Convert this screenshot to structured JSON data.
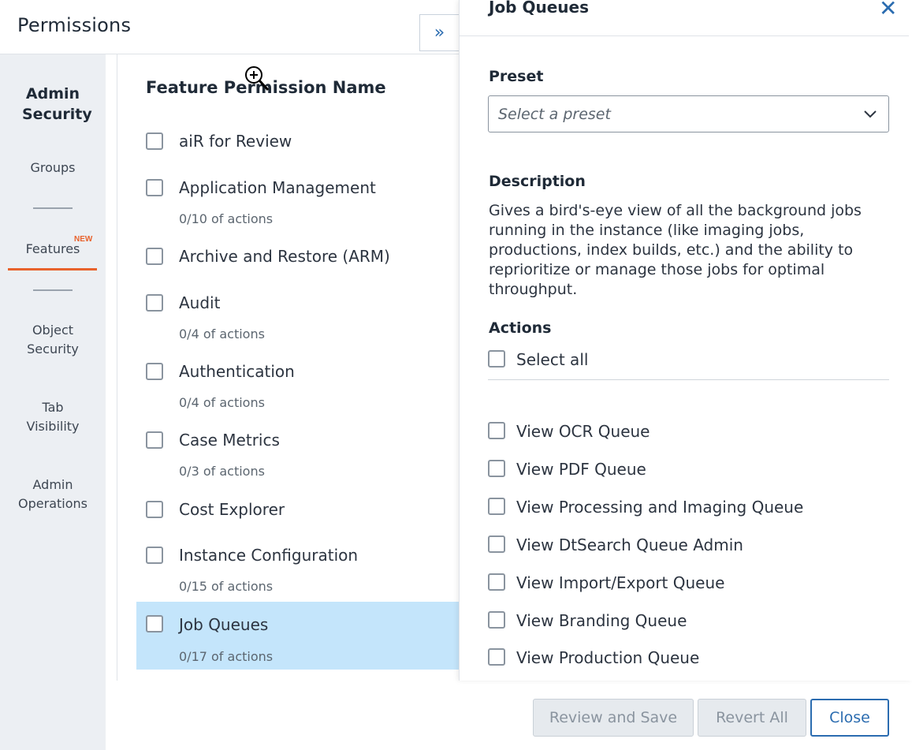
{
  "header": {
    "title": "Permissions",
    "collapse_icon": "»"
  },
  "nav": {
    "section_title": "Admin Security",
    "items": [
      {
        "label": "Groups"
      },
      {
        "label": "Features",
        "badge": "NEW"
      },
      {
        "label": "Object Security"
      },
      {
        "label": "Tab Visibility"
      },
      {
        "label": "Admin Operations"
      }
    ]
  },
  "features": {
    "heading": "Feature Permission Name",
    "rows": [
      {
        "label": "aiR for Review",
        "sub": ""
      },
      {
        "label": "Application Management",
        "sub": "0/10 of actions"
      },
      {
        "label": "Archive and Restore (ARM)",
        "sub": ""
      },
      {
        "label": "Audit",
        "sub": "0/4 of actions"
      },
      {
        "label": "Authentication",
        "sub": "0/4 of actions"
      },
      {
        "label": "Case Metrics",
        "sub": "0/3 of actions"
      },
      {
        "label": "Cost Explorer",
        "sub": ""
      },
      {
        "label": "Instance Configuration",
        "sub": "0/15 of actions"
      },
      {
        "label": "Job Queues",
        "sub": "0/17 of actions"
      }
    ]
  },
  "detail": {
    "title": "Job Queues",
    "close_icon": "✕",
    "preset_label": "Preset",
    "preset_placeholder": "Select a preset",
    "description_label": "Description",
    "description": "Gives a bird's-eye view of all the background jobs running in the instance (like imaging jobs, productions, index builds, etc.) and the ability to reprioritize or manage those jobs for optimal throughput.",
    "actions_label": "Actions",
    "select_all": "Select all",
    "actions": [
      "View OCR Queue",
      "View PDF Queue",
      "View Processing and Imaging Queue",
      "View DtSearch Queue Admin",
      "View Import/Export Queue",
      "View Branding Queue",
      "View Production Queue"
    ]
  },
  "footer": {
    "review_save": "Review and Save",
    "revert_all": "Revert All",
    "close": "Close"
  },
  "colors": {
    "accent": "#2b6cb0",
    "active_nav": "#e8622c",
    "selected_row": "#c4e5fb",
    "nav_bg": "#eceff3"
  }
}
